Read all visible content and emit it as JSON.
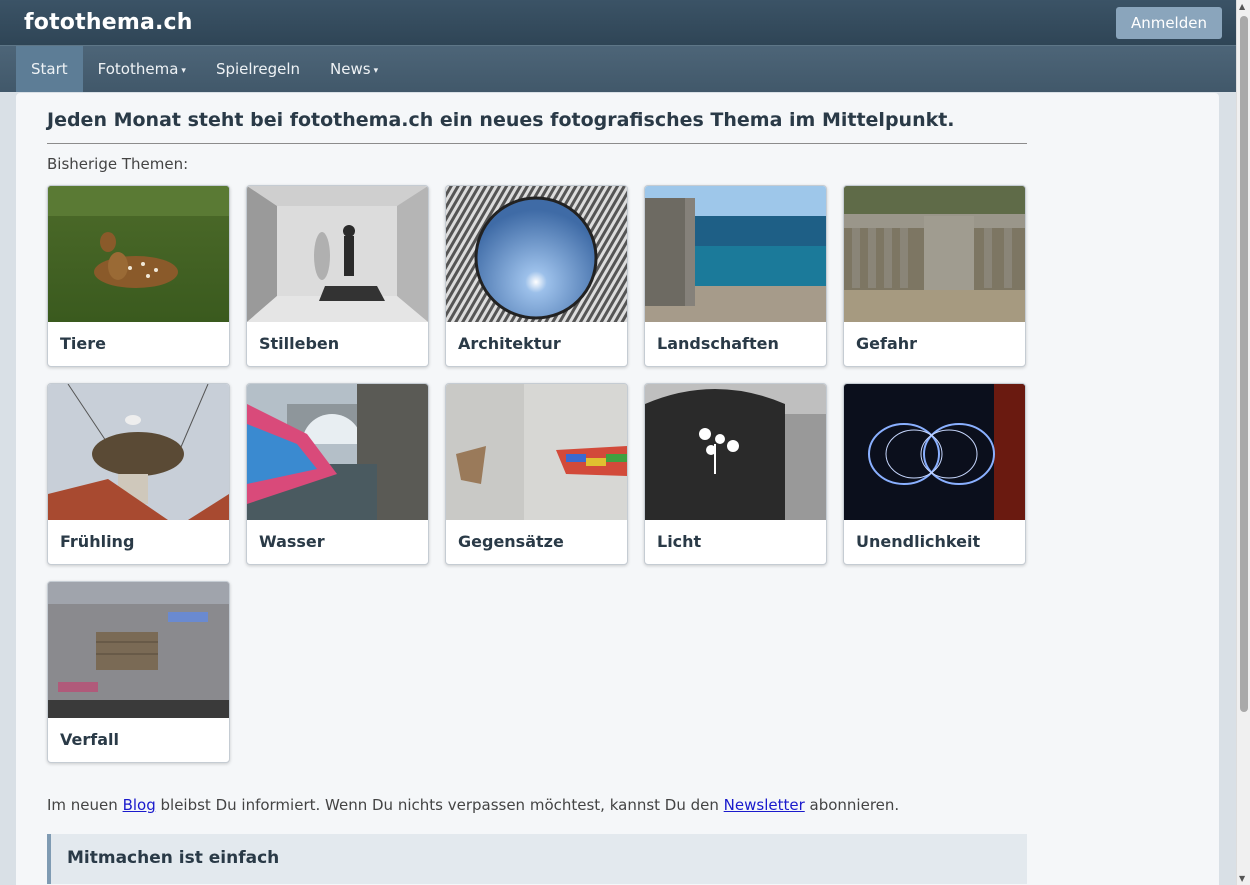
{
  "header": {
    "brand": "fotothema.ch",
    "login_label": "Anmelden"
  },
  "nav": {
    "items": [
      {
        "label": "Start",
        "active": true,
        "dropdown": false
      },
      {
        "label": "Fotothema",
        "active": false,
        "dropdown": true
      },
      {
        "label": "Spielregeln",
        "active": false,
        "dropdown": false
      },
      {
        "label": "News",
        "active": false,
        "dropdown": true
      }
    ],
    "caret": "▾"
  },
  "main": {
    "headline": "Jeden Monat steht bei fotothema.ch ein neues fotografisches Thema im Mittelpunkt.",
    "subhead": "Bisherige Themen:",
    "themes": [
      {
        "label": "Tiere"
      },
      {
        "label": "Stilleben"
      },
      {
        "label": "Architektur"
      },
      {
        "label": "Landschaften"
      },
      {
        "label": "Gefahr"
      },
      {
        "label": "Frühling"
      },
      {
        "label": "Wasser"
      },
      {
        "label": "Gegensätze"
      },
      {
        "label": "Licht"
      },
      {
        "label": "Unendlichkeit"
      },
      {
        "label": "Verfall"
      }
    ],
    "info": {
      "text1": "Im neuen ",
      "blog_link": "Blog",
      "text2": " bleibst Du informiert. Wenn Du nichts verpassen möchtest, kannst Du den ",
      "newsletter_link": "Newsletter",
      "text3": " abonnieren."
    },
    "callout_title": "Mitmachen ist einfach"
  },
  "colors": {
    "topbar": "#34495b",
    "navbar": "#475e70",
    "nav_active": "#5d7d96",
    "login_button": "#8aa5bc",
    "link": "#1a1acc",
    "callout_bg": "#e3e9ee",
    "callout_border": "#7f9bb3"
  }
}
